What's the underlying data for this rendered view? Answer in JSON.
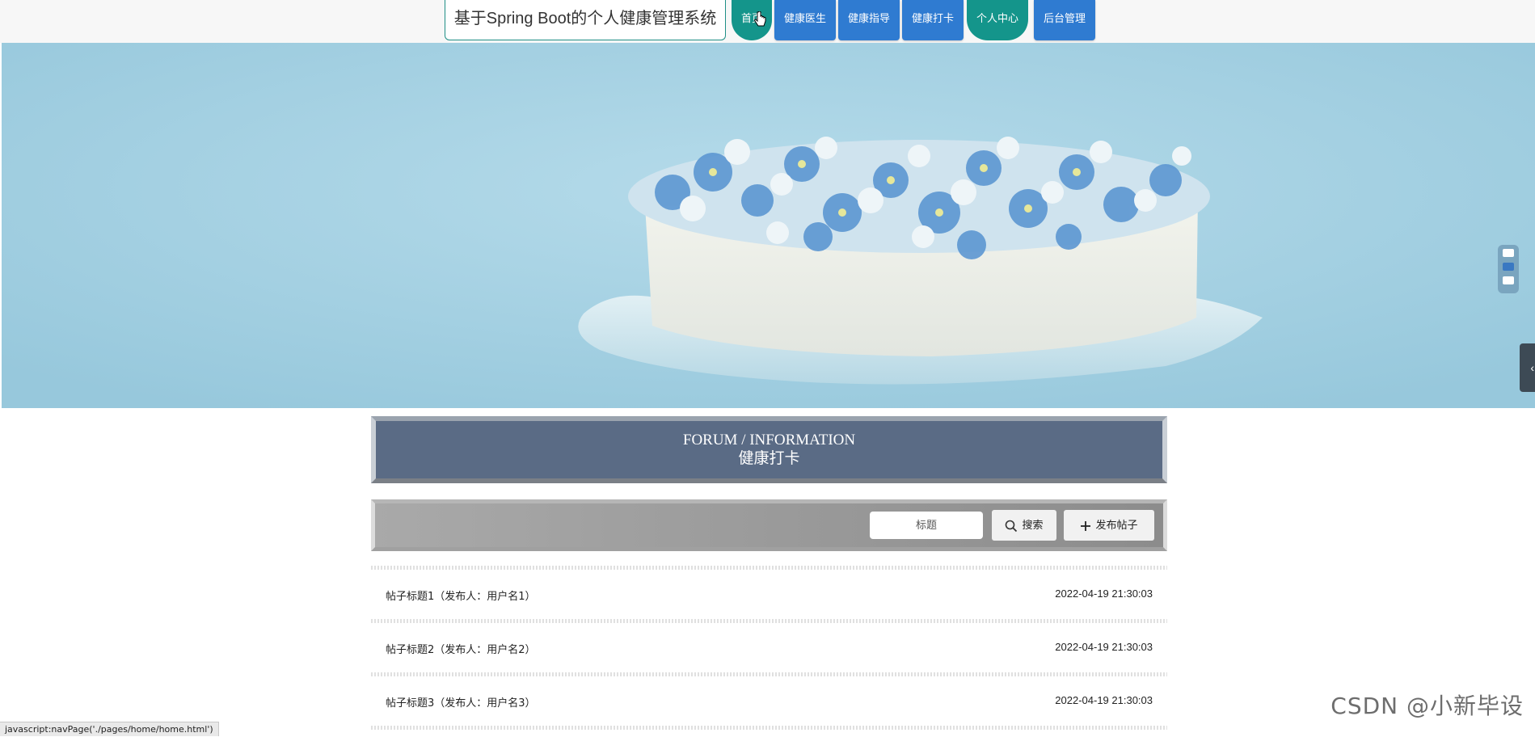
{
  "nav": {
    "system_title": "基于Spring Boot的个人健康管理系统",
    "items": [
      {
        "label": "首页"
      },
      {
        "label": "健康医生"
      },
      {
        "label": "健康指导"
      },
      {
        "label": "健康打卡"
      },
      {
        "label": "个人中心"
      },
      {
        "label": "后台管理"
      }
    ]
  },
  "section": {
    "title_en": "FORUM / INFORMATION",
    "title_cn": "健康打卡"
  },
  "search": {
    "placeholder": "标题",
    "search_label": "搜索",
    "publish_label": "发布帖子"
  },
  "posts": [
    {
      "title": "帖子标题1（发布人：用户名1）",
      "date": "2022-04-19 21:30:03"
    },
    {
      "title": "帖子标题2（发布人：用户名2）",
      "date": "2022-04-19 21:30:03"
    },
    {
      "title": "帖子标题3（发布人：用户名3）",
      "date": "2022-04-19 21:30:03"
    }
  ],
  "status_bar": {
    "text": "javascript:navPage('./pages/home/home.html')"
  },
  "watermark": "CSDN @小新毕设",
  "colors": {
    "nav_blue": "#2f7bd1",
    "nav_teal": "#14958b",
    "section_bg": "#5a6b85",
    "banner_bg": "#acd5e5"
  }
}
